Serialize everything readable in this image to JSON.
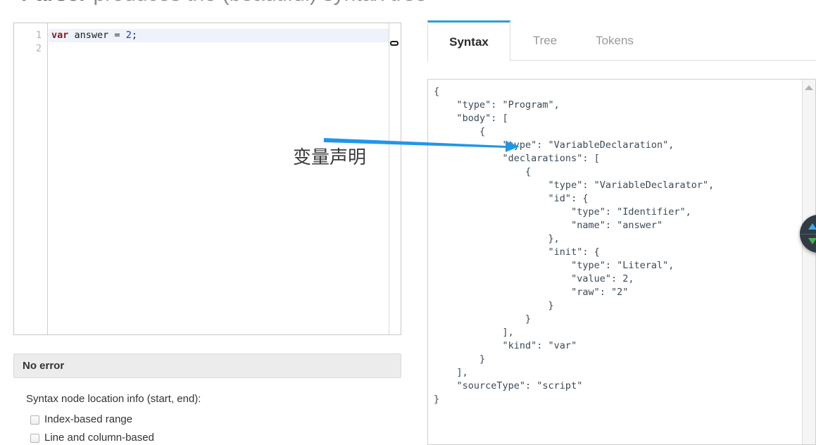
{
  "heading": {
    "strong": "Parser",
    "rest": " produces the (beautiful) syntax tree"
  },
  "editor": {
    "line_numbers": [
      "1",
      "2"
    ],
    "code": {
      "keyword": "var",
      "identifier": " answer ",
      "operator": "= ",
      "number": "2",
      "terminator": ";"
    },
    "full_line": "var answer = 2;"
  },
  "error_bar": {
    "text": "No error"
  },
  "location_info": {
    "label": "Syntax node location info (start, end):",
    "options": [
      {
        "label": "Index-based range",
        "checked": false
      },
      {
        "label": "Line and column-based",
        "checked": false
      }
    ]
  },
  "tabs": [
    {
      "id": "syntax",
      "label": "Syntax",
      "active": true
    },
    {
      "id": "tree",
      "label": "Tree",
      "active": false
    },
    {
      "id": "tokens",
      "label": "Tokens",
      "active": false
    }
  ],
  "syntax_output": "{\n    \"type\": \"Program\",\n    \"body\": [\n        {\n            \"type\": \"VariableDeclaration\",\n            \"declarations\": [\n                {\n                    \"type\": \"VariableDeclarator\",\n                    \"id\": {\n                        \"type\": \"Identifier\",\n                        \"name\": \"answer\"\n                    },\n                    \"init\": {\n                        \"type\": \"Literal\",\n                        \"value\": 2,\n                        \"raw\": \"2\"\n                    }\n                }\n            ],\n            \"kind\": \"var\"\n        }\n    ],\n    \"sourceType\": \"script\"\n}",
  "annotation": {
    "text": "变量声明",
    "arrow_color": "#2196e8"
  },
  "colors": {
    "active_tab_accent": "#2f9fd0",
    "keyword": "#8b1a1a",
    "number": "#1835d8",
    "json_text": "#3b4a58",
    "error_bar_bg": "#ececec",
    "float_widget_bg": "#303b45",
    "float_up_arrow": "#3da8e8",
    "float_down_arrow": "#4aaf4a"
  },
  "float_widget": {
    "up_icon": "arrow-up-icon",
    "down_icon": "arrow-down-icon"
  },
  "scrollbar": {
    "up_icon": "triangle-up-icon"
  }
}
